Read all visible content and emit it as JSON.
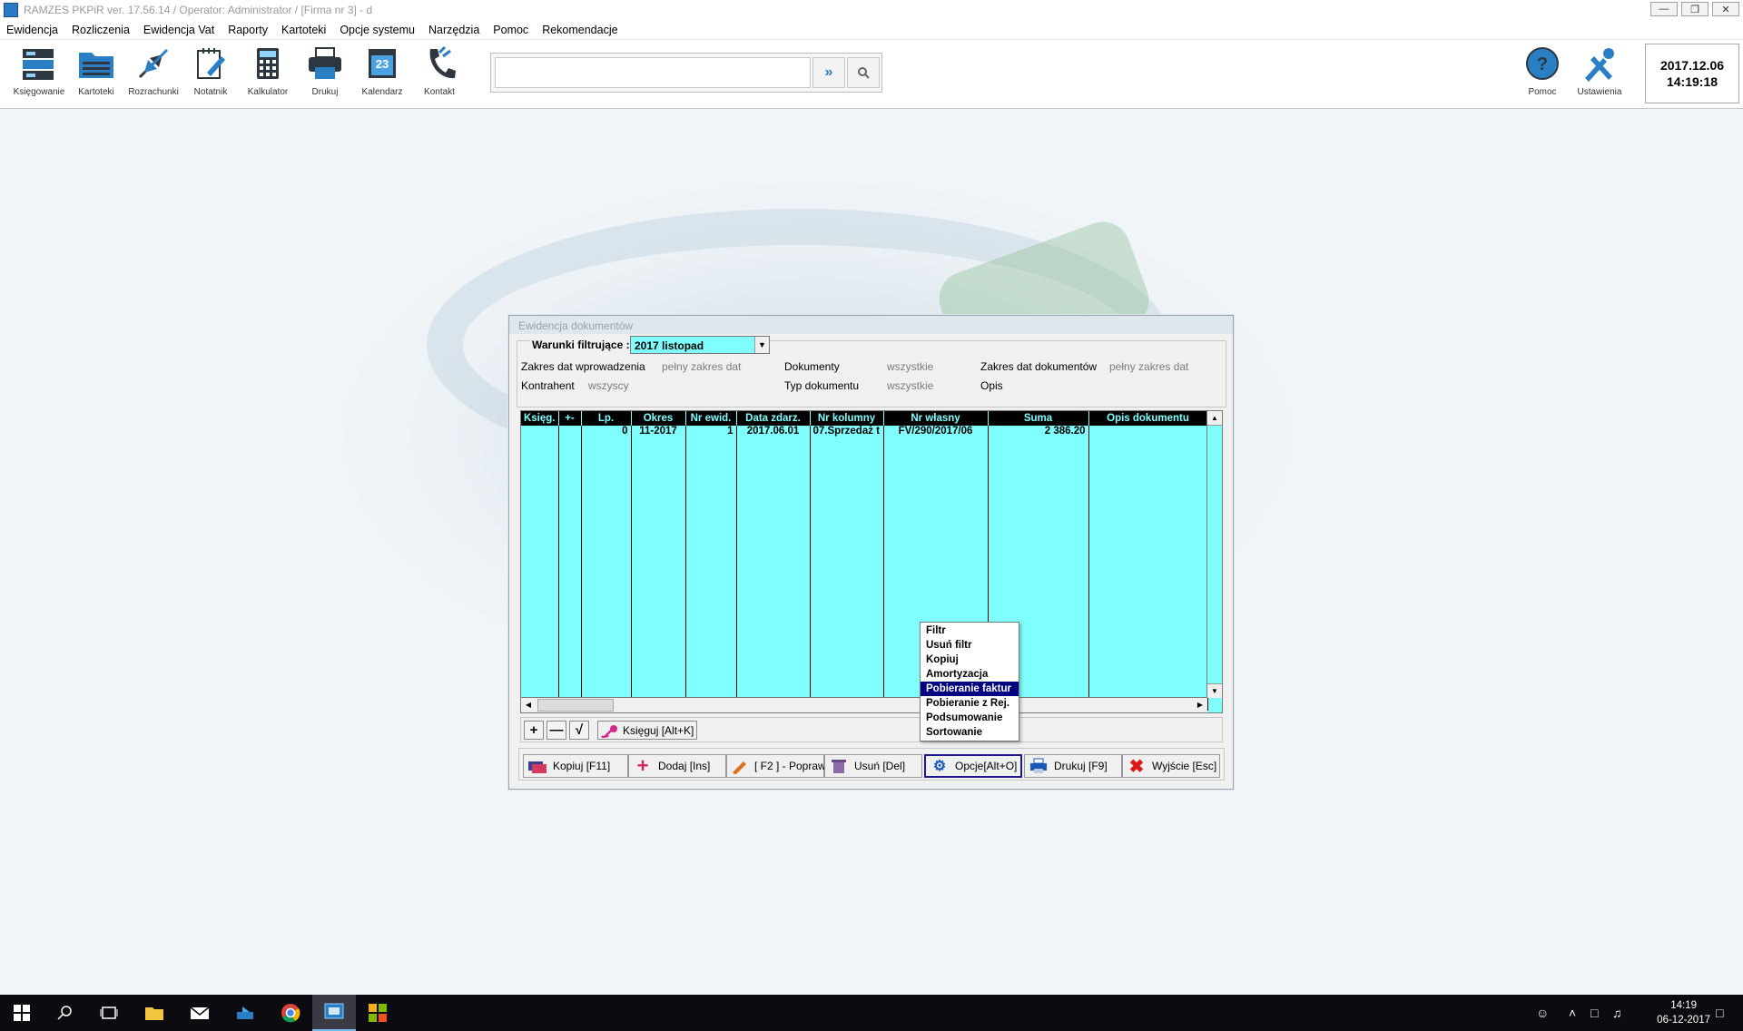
{
  "window": {
    "title": "RAMZES PKPiR ver. 17.56.14 /   Operator: Administrator /   [Firma nr 3] - d"
  },
  "menu": [
    "Ewidencja",
    "Rozliczenia",
    "Ewidencja Vat",
    "Raporty",
    "Kartoteki",
    "Opcje systemu",
    "Narzędzia",
    "Pomoc",
    "Rekomendacje"
  ],
  "toolbar": {
    "buttons": [
      "Księgowanie",
      "Kartoteki",
      "Rozrachunki",
      "Notatnik",
      "Kalkulator",
      "Drukuj",
      "Kalendarz",
      "Kontakt"
    ],
    "calendar_day": "23",
    "help_label": "Pomoc",
    "settings_label": "Ustawienia",
    "date": "2017.12.06",
    "time": "14:19:18"
  },
  "dialog": {
    "title": "Ewidencja dokumentów",
    "filter": {
      "label": "Warunki filtrujące :",
      "period": "2017 listopad",
      "zakres_dat_wpr_label": "Zakres dat  wprowadzenia",
      "zakres_dat_wpr_value": "pełny zakres dat",
      "dokumenty_label": "Dokumenty",
      "dokumenty_value": "wszystkie",
      "zakres_dat_dok_label": "Zakres dat  dokumentów",
      "zakres_dat_dok_value": "pełny zakres dat",
      "kontrahent_label": "Kontrahent",
      "kontrahent_value": "wszyscy",
      "typ_label": "Typ dokumentu",
      "typ_value": "wszystkie",
      "opis_label": "Opis"
    },
    "table": {
      "headers": [
        "Księg.",
        "+-",
        "Lp.",
        "Okres",
        "Nr ewid.",
        "Data zdarz.",
        "Nr kolumny",
        "Nr własny",
        "Suma",
        "Opis dokumentu"
      ],
      "rows": [
        [
          "",
          "",
          "0",
          "11-2017",
          "1",
          "2017.06.01",
          "07.Sprzedaż t",
          "FV/290/2017/06",
          "2 386.20",
          ""
        ]
      ]
    },
    "mini": {
      "ksieguj": "Księguj [Alt+K]"
    },
    "buttons": {
      "kopiuj": "Kopiuj  [F11]",
      "dodaj": "Dodaj     [Ins]",
      "popraw": "[ F2 ] - Popraw",
      "usun": "Usuń      [Del]",
      "opcje": "Opcje[Alt+O]",
      "drukuj": "Drukuj      [F9]",
      "wyjscie": "Wyjście  [Esc]"
    },
    "context_menu": [
      "Filtr",
      "Usuń filtr",
      "Kopiuj",
      "Amortyzacja",
      "Pobieranie faktur",
      "Pobieranie z Rej.",
      "Podsumowanie",
      "Sortowanie"
    ],
    "context_selected": "Pobieranie faktur"
  },
  "taskbar": {
    "time": "14:19",
    "date": "06-12-2017"
  }
}
